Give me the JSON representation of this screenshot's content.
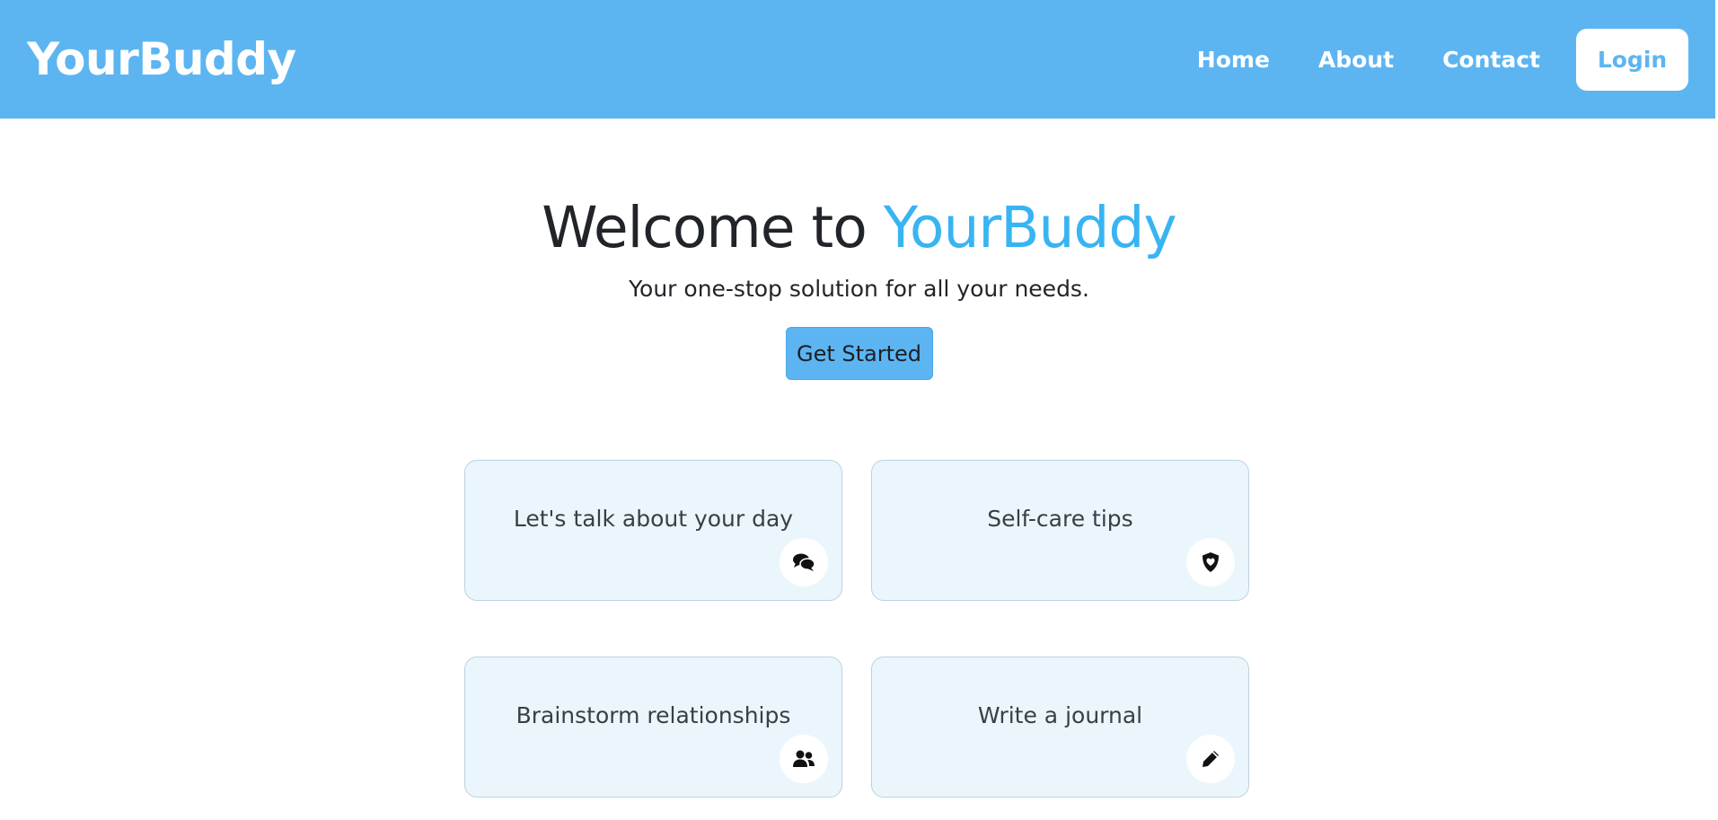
{
  "navbar": {
    "brand": "YourBuddy",
    "links": [
      "Home",
      "About",
      "Contact"
    ],
    "login_label": "Login",
    "background_color": "#5cb5f1"
  },
  "hero": {
    "title_prefix": "Welcome to ",
    "title_accent": "YourBuddy",
    "subtitle": "Your one-stop solution for all your needs.",
    "cta_label": "Get Started",
    "accent_color": "#38b4f3"
  },
  "cards": [
    {
      "label": "Let's talk about your day",
      "icon": "chat-bubbles-icon"
    },
    {
      "label": "Self-care tips",
      "icon": "shield-heart-icon"
    },
    {
      "label": "Brainstorm relationships",
      "icon": "users-icon"
    },
    {
      "label": "Write a journal",
      "icon": "pencil-icon"
    }
  ]
}
